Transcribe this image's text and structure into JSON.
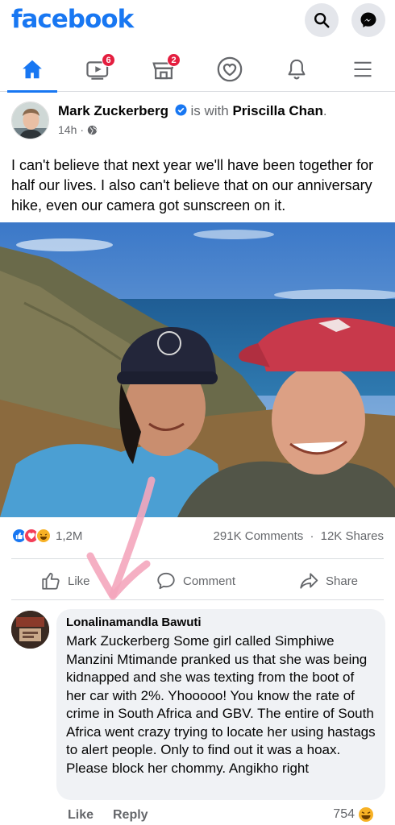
{
  "app": {
    "logo": "facebook"
  },
  "nav": {
    "video_badge": "6",
    "marketplace_badge": "2"
  },
  "post": {
    "author": "Mark Zuckerberg",
    "with_text": " is with ",
    "tagged": "Priscilla Chan",
    "period": ".",
    "time": "14h",
    "separator": "·",
    "text": "I can't believe that next year we'll have been together for half our lives. I also can't believe that on our anniversary hike, even our camera got sunscreen on it."
  },
  "stats": {
    "reactions": "1,2M",
    "comments": "291K Comments",
    "dot": "·",
    "shares": "12K Shares"
  },
  "actions": {
    "like": "Like",
    "comment": "Comment",
    "share": "Share"
  },
  "comment": {
    "name": "Lonalinamandla Bawuti",
    "text": "Mark Zuckerberg Some girl called Simphiwe Manzini Mtimande pranked us that she was being kidnapped and she was texting from the boot of her car with 2%. Yhooooo! You know the rate of crime in South Africa and GBV. The entire of South Africa went crazy trying to locate her using hastags to alert people. Only to find out it was a hoax. Please block her chommy. Angikho right",
    "like": "Like",
    "reply": "Reply",
    "reaction_count": "754"
  },
  "colors": {
    "brand": "#1877f2",
    "badge": "#e41e3f",
    "secondary_text": "#65676b",
    "overlay_arrow": "#f4a6bd"
  },
  "icons": {
    "search": "search-icon",
    "messenger": "messenger-icon",
    "home": "home-icon",
    "video": "video-icon",
    "marketplace": "marketplace-icon",
    "dating": "heart-icon",
    "notifications": "bell-icon",
    "menu": "menu-icon"
  }
}
